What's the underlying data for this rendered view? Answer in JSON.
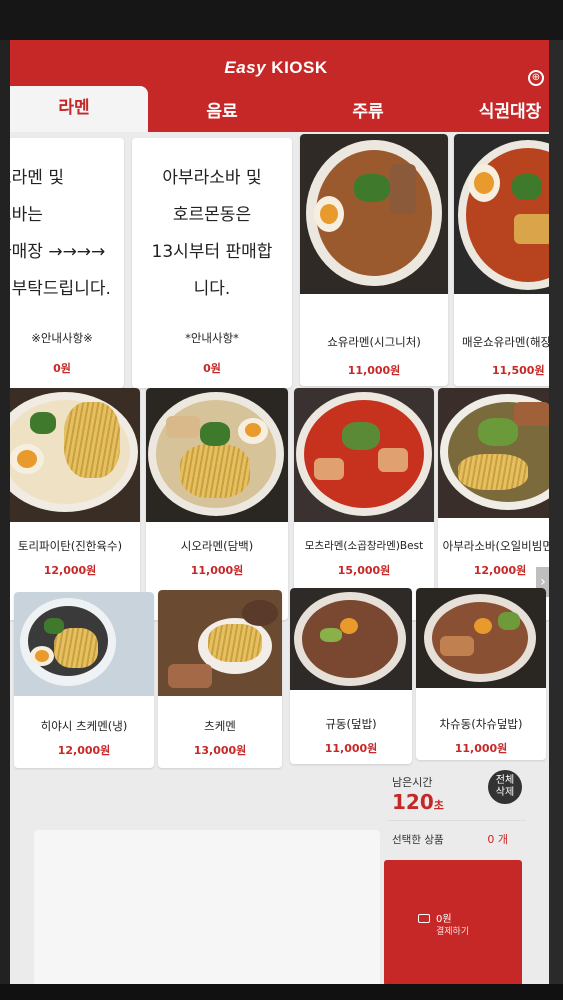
{
  "app": {
    "brand_prefix": "Easy",
    "brand_suffix": "KIOSK",
    "language_icon": "globe-icon"
  },
  "tabs": [
    {
      "label": "라멘",
      "active": true
    },
    {
      "label": "음료",
      "active": false
    },
    {
      "label": "주류",
      "active": false
    },
    {
      "label": "식권대장",
      "active": false
    }
  ],
  "menu": [
    {
      "text": "츠라멘 및\n소바는\n라매장 →→→→\n세부탁드립니다.",
      "name": "※안내사항※",
      "price": "0원"
    },
    {
      "text": "아부라소바 및\n호르몬동은\n13시부터 판매합\n니다.",
      "name": "*안내사항*",
      "price": "0원"
    },
    {
      "name": "쇼유라멘(시그니처)",
      "price": "11,000원"
    },
    {
      "name": "매운쇼유라멘(해장라",
      "price": "11,500원"
    },
    {
      "name": "토리파이탄(진한육수)",
      "price": "12,000원"
    },
    {
      "name": "시오라멘(담백)",
      "price": "11,000원"
    },
    {
      "name": "모츠라멘(소곱창라멘)Best",
      "price": "15,000원"
    },
    {
      "name": "아부라소바(오일비빔면)",
      "price": "12,000원"
    },
    {
      "name": "히야시 츠케멘(냉)",
      "price": "12,000원"
    },
    {
      "name": "츠케멘",
      "price": "13,000원"
    },
    {
      "name": "규동(덮밥)",
      "price": "11,000원"
    },
    {
      "name": "차슈동(차슈덮밥)",
      "price": "11,000원"
    }
  ],
  "sidebar": {
    "remaining_label": "남은시간",
    "remaining_value": "120",
    "remaining_unit": "초",
    "delete_all_label": "전체\n삭제",
    "selected_label": "선택한 상품",
    "selected_count": "0",
    "selected_unit": "개",
    "pay_amount": "0원",
    "pay_label": "결제하기"
  },
  "colors": {
    "accent": "#c62828",
    "background": "#ebebeb"
  }
}
